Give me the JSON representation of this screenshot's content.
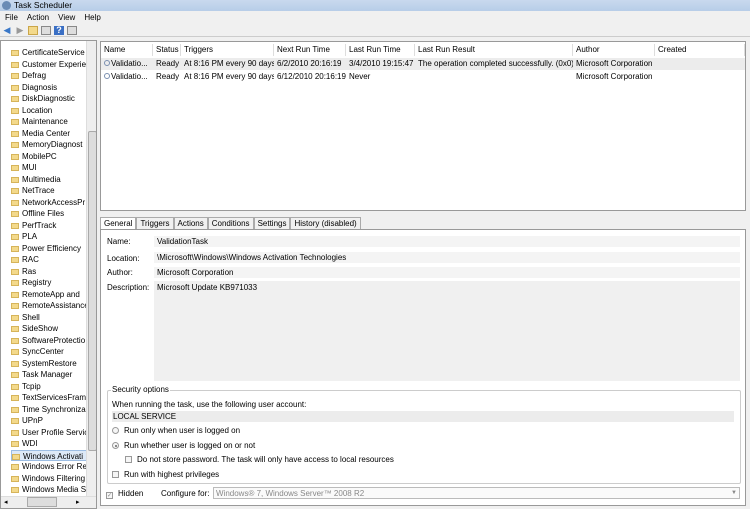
{
  "window": {
    "title": "Task Scheduler"
  },
  "menu": [
    "File",
    "Action",
    "View",
    "Help"
  ],
  "tree": {
    "items": [
      "CertificateService",
      "Customer Experie",
      "Defrag",
      "Diagnosis",
      "DiskDiagnostic",
      "Location",
      "Maintenance",
      "Media Center",
      "MemoryDiagnost",
      "MobilePC",
      "MUI",
      "Multimedia",
      "NetTrace",
      "NetworkAccessPr",
      "Offline Files",
      "PerfTrack",
      "PLA",
      "Power Efficiency",
      "RAC",
      "Ras",
      "Registry",
      "RemoteApp and",
      "RemoteAssistance",
      "Shell",
      "SideShow",
      "SoftwareProtectio",
      "SyncCenter",
      "SystemRestore",
      "Task Manager",
      "Tcpip",
      "TextServicesFram",
      "Time Synchroniza",
      "UPnP",
      "User Profile Servic",
      "WDI",
      "Windows Activati",
      "Windows Error Re",
      "Windows Filtering",
      "Windows Media S",
      "Windows Remote"
    ],
    "selected_index": 35
  },
  "tasks": {
    "columns": [
      "Name",
      "Status",
      "Triggers",
      "Next Run Time",
      "Last Run Time",
      "Last Run Result",
      "Author",
      "Created"
    ],
    "rows": [
      [
        "Validatio...",
        "Ready",
        "At 8:16 PM every 90 days",
        "6/2/2010 20:16:19",
        "3/4/2010 19:15:47",
        "The operation completed successfully. (0x0)",
        "Microsoft Corporation",
        ""
      ],
      [
        "Validatio...",
        "Ready",
        "At 8:16 PM every 90 days",
        "6/12/2010 20:16:19",
        "Never",
        "",
        "Microsoft Corporation",
        ""
      ]
    ]
  },
  "tabs": [
    "General",
    "Triggers",
    "Actions",
    "Conditions",
    "Settings",
    "History (disabled)"
  ],
  "general": {
    "name_label": "Name:",
    "name": "ValidationTask",
    "location_label": "Location:",
    "location": "\\Microsoft\\Windows\\Windows Activation Technologies",
    "author_label": "Author:",
    "author": "Microsoft Corporation",
    "description_label": "Description:",
    "description": "Microsoft Update KB971033",
    "security_title": "Security options",
    "account_prompt": "When running the task, use the following user account:",
    "account": "LOCAL SERVICE",
    "radio_logged_on": "Run only when user is logged on",
    "radio_whether": "Run whether user is logged on or not",
    "radio_selected": "Run whether user is logged on or not",
    "no_store_password": "Do not store password.  The task will only have access to local resources",
    "highest_privileges": "Run with highest privileges",
    "hidden_label": "Hidden",
    "hidden_checked": true,
    "configure_label": "Configure for:",
    "configure_value": "Windows® 7, Windows Server™ 2008 R2"
  }
}
